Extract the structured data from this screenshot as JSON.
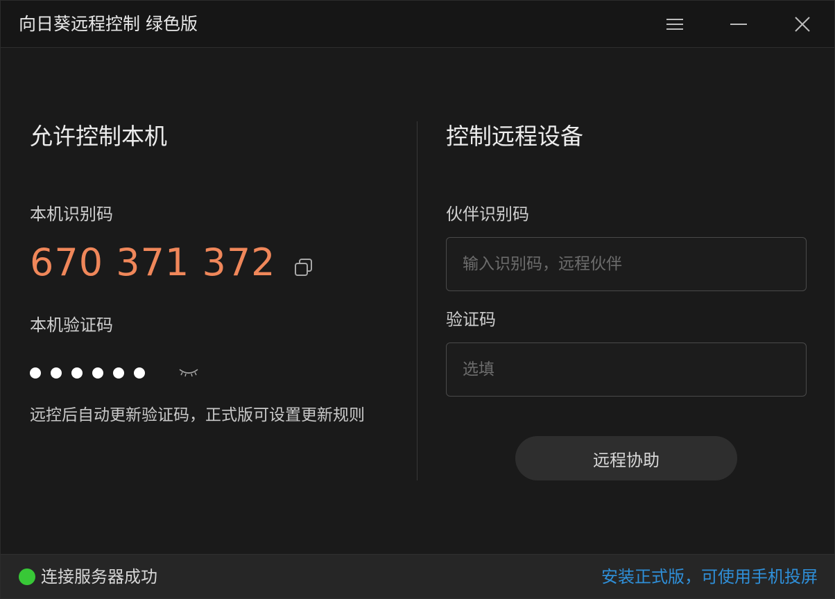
{
  "app": {
    "title": "向日葵远程控制 绿色版"
  },
  "titlebar": {
    "icons": [
      "menu-icon",
      "minimize-icon",
      "close-icon"
    ]
  },
  "allow_control": {
    "title": "允许控制本机",
    "id_label": "本机识别码",
    "id_value": "670 371 372",
    "code_label": "本机验证码",
    "code_masked_count": 6,
    "hint": "远控后自动更新验证码，正式版可设置更新规则"
  },
  "remote_control": {
    "title": "控制远程设备",
    "partner_label": "伙伴识别码",
    "partner_placeholder": "输入识别码，远程伙伴",
    "partner_value": "",
    "verify_label": "验证码",
    "verify_placeholder": "选填",
    "verify_value": "",
    "assist_button": "远程协助"
  },
  "status": {
    "text": "连接服务器成功",
    "link": "安装正式版，可使用手机投屏"
  },
  "colors": {
    "accent_id": "#f0875a",
    "status_ok": "#38c837",
    "link": "#2f8fd8",
    "background": "#1a1a1a"
  }
}
